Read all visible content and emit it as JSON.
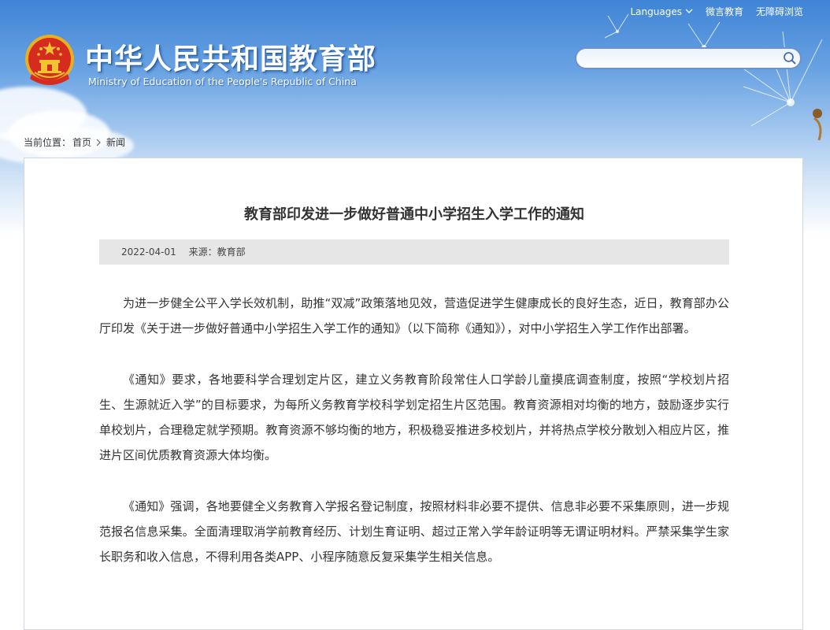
{
  "header": {
    "title_cn": "中华人民共和国教育部",
    "title_en": "Ministry of Education of the People's Republic of China",
    "nav": [
      {
        "label": "Languages"
      },
      {
        "label": "微言教育"
      },
      {
        "label": "无障碍浏览"
      }
    ],
    "search": {
      "placeholder": "",
      "value": ""
    }
  },
  "breadcrumb": {
    "prefix": "当前位置：",
    "items": [
      "首页",
      "新闻"
    ]
  },
  "article": {
    "title": "教育部印发进一步做好普通中小学招生入学工作的通知",
    "date": "2022-04-01",
    "source": "来源：教育部",
    "paragraphs": [
      "为进一步健全公平入学长效机制，助推“双减”政策落地见效，营造促进学生健康成长的良好生态，近日，教育部办公厅印发《关于进一步做好普通中小学招生入学工作的通知》（以下简称《通知》），对中小学招生入学工作作出部署。",
      "《通知》要求，各地要科学合理划定片区，建立义务教育阶段常住人口学龄儿童摸底调查制度，按照“学校划片招生、生源就近入学”的目标要求，为每所义务教育学校科学划定招生片区范围。教育资源相对均衡的地方，鼓励逐步实行单校划片，合理稳定就学预期。教育资源不够均衡的地方，积极稳妥推进多校划片，并将热点学校分散划入相应片区，推进片区间优质教育资源大体均衡。",
      "《通知》强调，各地要健全义务教育入学报名登记制度，按照材料非必要不提供、信息非必要不采集原则，进一步规范报名信息采集。全面清理取消学前教育经历、计划生育证明、超过正常入学年龄证明等无谓证明材料。严禁采集学生家长职务和收入信息，不得利用各类APP、小程序随意反复采集学生相关信息。"
    ]
  },
  "icons": {
    "emblem": "national-emblem-icon",
    "search": "search-icon",
    "chevron": "chevron-down-icon",
    "breadcrumb_sep": "chevron-right-icon"
  },
  "colors": {
    "sky_top": "#3f84d6",
    "panel_border": "#cfd6de",
    "meta_bg": "#e6e6e6",
    "text": "#333333"
  }
}
